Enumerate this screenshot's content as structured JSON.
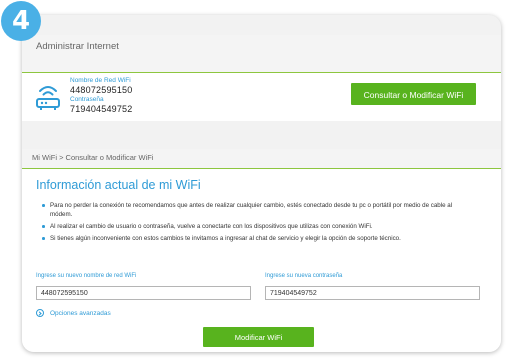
{
  "step": {
    "number": "4"
  },
  "section1": {
    "title": "Administrar Internet",
    "network_name_label": "Nombre de Red WiFi",
    "network_name": "448072595150",
    "password_label": "Contraseña",
    "password": "719404549752",
    "consult_button": "Consultar o Modificar WiFi",
    "icon": "router-icon"
  },
  "section2": {
    "breadcrumb": "Mi WiFi > Consultar o Modificar WiFi",
    "title": "Información actual de mi WiFi",
    "notes": [
      "Para no perder la conexión te recomendamos que antes de realizar cualquier cambio, estés conectado desde tu pc o portátil por medio de cable al módem.",
      "Al realizar el cambio de usuario o contraseña, vuelve a conectarte con los dispositivos que utilizas con conexión WiFi.",
      "Si tienes algún inconveniente con estos cambios te invitamos a ingresar al chat de servicio y elegir la opción de soporte técnico."
    ],
    "new_name_label": "Ingrese su nuevo nombre de red WiFi",
    "new_name_value": "448072595150",
    "new_password_label": "Ingrese su nueva contraseña",
    "new_password_value": "719404549752",
    "advanced_options": "Opciones avanzadas",
    "advanced_icon": "chevron-right-circle-icon",
    "modify_button": "Modificar WiFi"
  },
  "colors": {
    "accent_blue": "#2f9bd6",
    "badge_blue": "#4ab0e6",
    "button_green": "#58b31e",
    "divider_green": "#8dc63f"
  }
}
